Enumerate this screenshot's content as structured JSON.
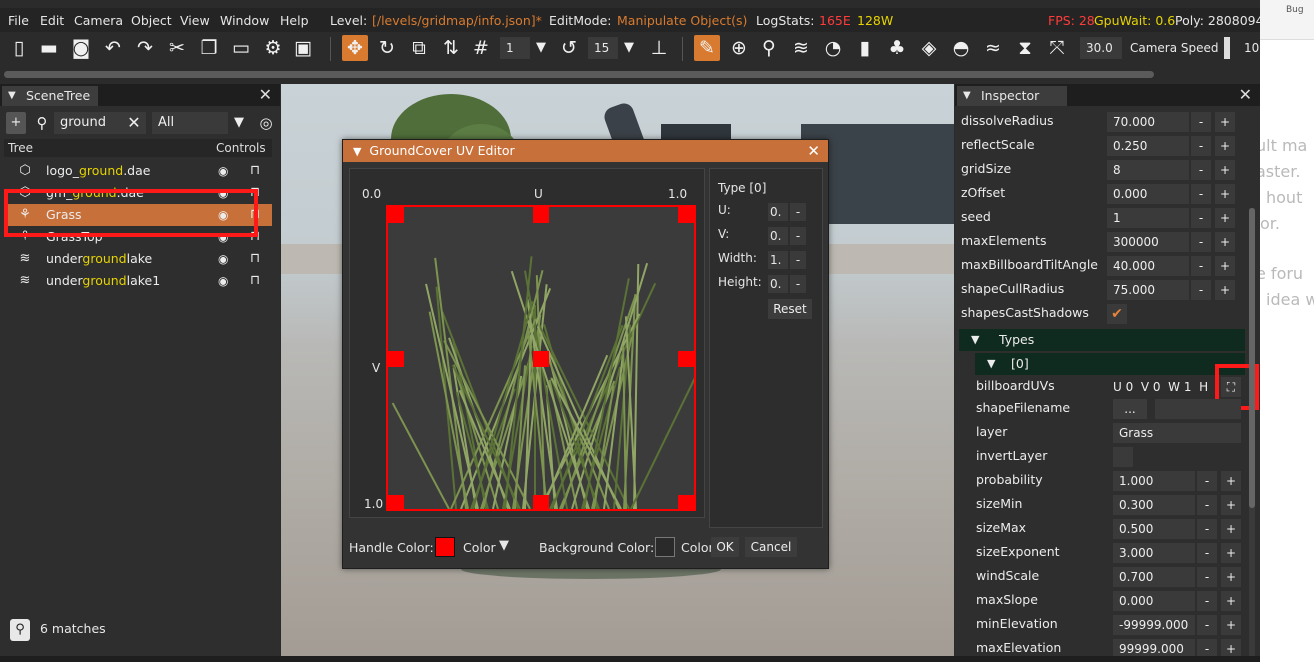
{
  "menu": {
    "items": [
      "File",
      "Edit",
      "Camera",
      "Object",
      "View",
      "Window",
      "Help"
    ],
    "level_label": "Level:",
    "level_value": "[/levels/gridmap/info.json]*",
    "editmode_label": "EditMode:",
    "editmode_value": "Manipulate Object(s)",
    "logstats_label": "LogStats:",
    "logstats_errors": "165E",
    "logstats_warnings": "128W",
    "fps": "FPS: 28",
    "gpuwait": "GpuWait: 0.6",
    "poly": "Poly: 2808094"
  },
  "toolbar": {
    "grid_value": "1",
    "rotate_value": "15",
    "camera_speed_value": "30.0",
    "camera_speed_label": "Camera Speed",
    "extra_value": "10"
  },
  "scene_tree": {
    "tab_label": "SceneTree",
    "search_value": "ground",
    "filter_value": "All",
    "col_tree": "Tree",
    "col_controls": "Controls",
    "rows": [
      {
        "pre": "logo_",
        "hl": "ground",
        "post": ".dae",
        "icon": "cube-icon",
        "selected": false
      },
      {
        "pre": "gm_",
        "hl": "ground",
        "post": ".dae",
        "icon": "cube-icon",
        "selected": false
      },
      {
        "pre": "Grass",
        "hl": "",
        "post": "",
        "icon": "grass-icon",
        "selected": true
      },
      {
        "pre": "GrassTop",
        "hl": "",
        "post": "",
        "icon": "grass-icon",
        "selected": false
      },
      {
        "pre": "under",
        "hl": "ground",
        "post": "lake",
        "icon": "water-icon",
        "selected": false
      },
      {
        "pre": "under",
        "hl": "ground",
        "post": "lake1",
        "icon": "water-icon",
        "selected": false
      }
    ],
    "matches_text": "6 matches"
  },
  "uv_editor": {
    "title": "GroundCover UV Editor",
    "u_start": "0.0",
    "u_label": "U",
    "u_end": "1.0",
    "v_label": "V",
    "v_end": "1.0",
    "type_label": "Type [0]",
    "fields": [
      {
        "label": "U:",
        "value": "0."
      },
      {
        "label": "V:",
        "value": "0."
      },
      {
        "label": "Width:",
        "value": "1."
      },
      {
        "label": "Height:",
        "value": "0."
      }
    ],
    "minus": "-",
    "reset_label": "Reset",
    "handle_color_label": "Handle Color:",
    "handle_color_value": "#ff0000",
    "color_dropdown_label": "Color",
    "background_color_label": "Background Color:",
    "background_color_value": "#2a2a2a",
    "color_dropdown2_label": "Color",
    "ok_label": "OK",
    "cancel_label": "Cancel"
  },
  "inspector": {
    "tab_label": "Inspector",
    "properties": [
      {
        "name": "dissolveRadius",
        "value": "70.000"
      },
      {
        "name": "reflectScale",
        "value": "0.250"
      },
      {
        "name": "gridSize",
        "value": "8"
      },
      {
        "name": "zOffset",
        "value": "0.000"
      },
      {
        "name": "seed",
        "value": "1"
      },
      {
        "name": "maxElements",
        "value": "300000"
      },
      {
        "name": "maxBillboardTiltAngle",
        "value": "40.000"
      },
      {
        "name": "shapeCullRadius",
        "value": "75.000"
      }
    ],
    "shapes_cast_shadows_label": "shapesCastShadows",
    "types_group_label": "Types",
    "type0_group_label": "[0]",
    "billboard_uvs_label": "billboardUVs",
    "billboard_uvs_value": "U 0  V 0  W 1  H",
    "shape_filename_label": "shapeFilename",
    "shape_filename_button": "...",
    "layer_label": "layer",
    "layer_value": "Grass",
    "invert_layer_label": "invertLayer",
    "type_properties": [
      {
        "name": "probability",
        "value": "1.000"
      },
      {
        "name": "sizeMin",
        "value": "0.300"
      },
      {
        "name": "sizeMax",
        "value": "0.500"
      },
      {
        "name": "sizeExponent",
        "value": "3.000"
      },
      {
        "name": "windScale",
        "value": "0.700"
      },
      {
        "name": "maxSlope",
        "value": "0.000"
      },
      {
        "name": "minElevation",
        "value": "-99999.000"
      },
      {
        "name": "maxElevation",
        "value": "99999.000"
      }
    ],
    "minus": "-",
    "plus": "+"
  },
  "background_page": {
    "bug_label": "Bug",
    "ghost_lines": [
      "ult ma",
      "aster.",
      "hout",
      "or.",
      "e foru",
      "idea w"
    ]
  },
  "colors": {
    "accent": "#c8703a",
    "highlight_text": "#e6d300",
    "selection_box": "#ff1a1a"
  }
}
